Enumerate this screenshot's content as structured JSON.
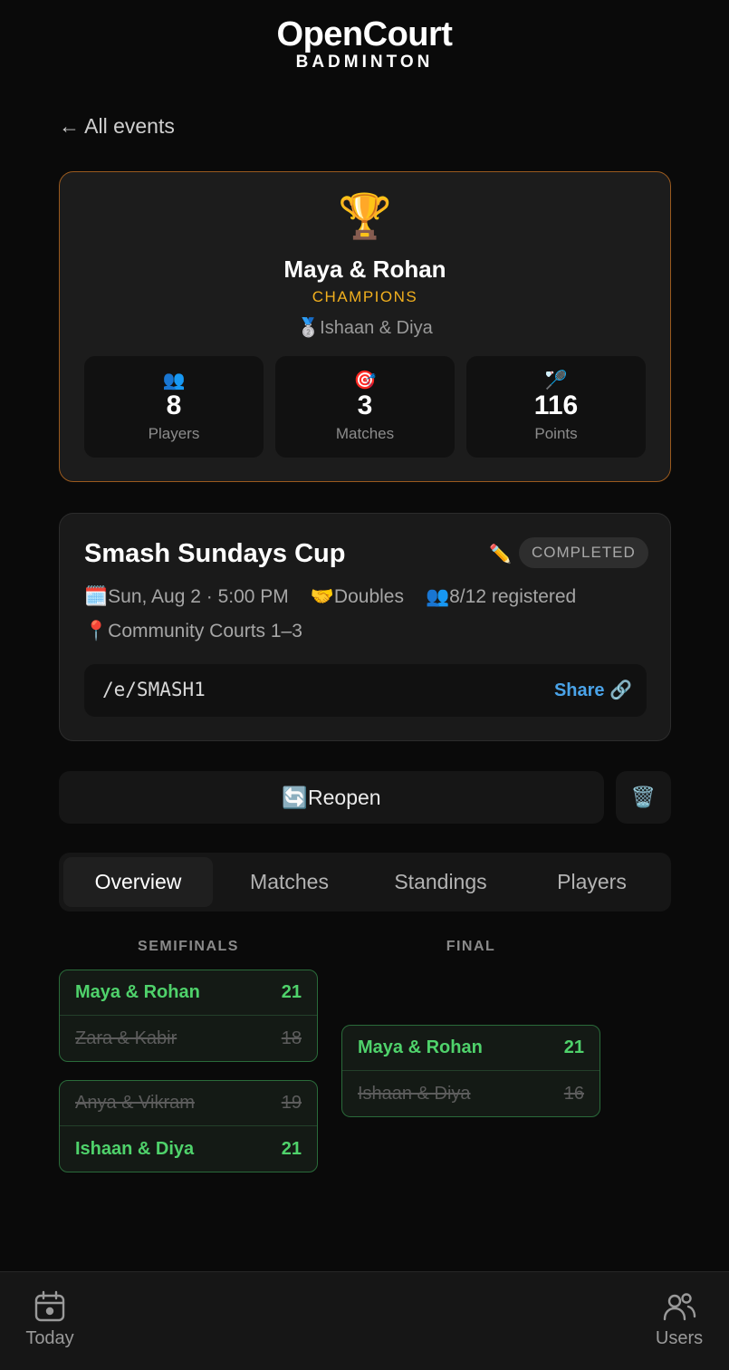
{
  "brand": {
    "name": "OpenCourt",
    "sub": "BADMINTON"
  },
  "nav": {
    "back_label": "← All events"
  },
  "champions": {
    "trophy_icon": "🏆",
    "name": "Maya & Rohan",
    "tag": "CHAMPIONS",
    "runner_up": "🥈Ishaan & Diya",
    "stats": [
      {
        "icon": "👥",
        "value": "8",
        "label": "Players"
      },
      {
        "icon": "🎯",
        "value": "3",
        "label": "Matches"
      },
      {
        "icon": "🏸",
        "value": "116",
        "label": "Points"
      }
    ]
  },
  "event": {
    "title": "Smash Sundays Cup",
    "edit_icon": "✏️",
    "status": "COMPLETED",
    "date": "🗓️Sun, Aug 2 · 5:00 PM",
    "format": "🤝Doubles",
    "registered": "👥8/12 registered",
    "location": "📍Community Courts 1–3",
    "share_code": "/e/SMASH1",
    "share_label": "Share 🔗"
  },
  "actions": {
    "reopen_label": "🔄Reopen",
    "delete_icon": "🗑️"
  },
  "tabs": [
    "Overview",
    "Matches",
    "Standings",
    "Players"
  ],
  "bracket": {
    "rounds": [
      "SEMIFINALS",
      "FINAL"
    ],
    "semifinals": [
      {
        "team1": "Maya & Rohan",
        "score1": "21",
        "team2": "Zara & Kabir",
        "score2": "18",
        "winner": 1
      },
      {
        "team1": "Anya & Vikram",
        "score1": "19",
        "team2": "Ishaan & Diya",
        "score2": "21",
        "winner": 2
      }
    ],
    "final": {
      "team1": "Maya & Rohan",
      "score1": "21",
      "team2": "Ishaan & Diya",
      "score2": "16",
      "winner": 1
    }
  },
  "bottom_nav": [
    {
      "icon": "calendar-icon",
      "label": "Today"
    },
    {
      "icon": "users-icon",
      "label": "Users"
    }
  ],
  "colors": {
    "winner": "#4fd26b",
    "champion_accent": "#f2b01e",
    "link": "#4aa3e8",
    "card_border": "#9a5a1e"
  }
}
